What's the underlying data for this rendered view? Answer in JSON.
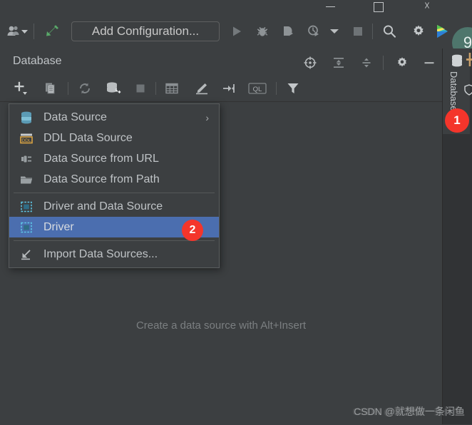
{
  "window": {
    "controls": {
      "minimize": "—",
      "maximize": "□",
      "close": "✕"
    }
  },
  "main_toolbar": {
    "profile_icon": "people-icon",
    "build_icon": "build-hammer-icon",
    "add_configuration_label": "Add Configuration...",
    "run_icon": "run-icon",
    "debug_icon": "debug-bug-icon",
    "coverage_icon": "run-with-coverage-icon",
    "profiler_icon": "profiler-icon",
    "profiler_dropdown_icon": "chevron-down-icon",
    "stop_icon": "stop-icon",
    "search_icon": "search-icon",
    "settings_icon": "gear-icon",
    "brand_icon": "ide-brand-icon",
    "avatar_label": "9"
  },
  "database_panel": {
    "title": "Database",
    "header_icons": {
      "locate": "locate-crosshair-icon",
      "expand_all": "expand-all-icon",
      "collapse_all": "collapse-all-icon",
      "settings": "gear-icon",
      "hide": "hide-minimize-icon"
    },
    "toolbar_icons": {
      "add": "plus-add-icon",
      "copy": "duplicate-icon",
      "refresh": "refresh-sync-icon",
      "db_tools": "database-tools-icon",
      "stop": "stop-icon",
      "table": "table-grid-icon",
      "edit": "edit-pencil-icon",
      "jump_to": "jump-to-icon",
      "ql": "QL",
      "filter": "filter-funnel-icon"
    },
    "empty_hint": "Create a data source with Alt+Insert"
  },
  "popup_menu": {
    "items": [
      {
        "label": "Data Source",
        "icon": "database-icon",
        "has_submenu": true,
        "submenu_arrow": "›",
        "selected": false,
        "separator_after": false
      },
      {
        "label": "DDL Data Source",
        "icon": "ddl-icon",
        "has_submenu": false,
        "selected": false,
        "separator_after": false
      },
      {
        "label": "Data Source from URL",
        "icon": "url-plug-icon",
        "has_submenu": false,
        "selected": false,
        "separator_after": false
      },
      {
        "label": "Data Source from Path",
        "icon": "folder-icon",
        "has_submenu": false,
        "selected": false,
        "separator_after": true
      },
      {
        "label": "Driver and Data Source",
        "icon": "driver-icon",
        "has_submenu": false,
        "selected": false,
        "separator_after": false
      },
      {
        "label": "Driver",
        "icon": "driver-icon",
        "has_submenu": false,
        "selected": true,
        "separator_after": true
      },
      {
        "label": "Import Data Sources...",
        "icon": "import-arrow-icon",
        "has_submenu": false,
        "selected": false,
        "separator_after": false
      }
    ]
  },
  "right_stripe": {
    "database_label": "Database",
    "database_icon": "database-icon",
    "hash_icon": "hash-icon",
    "shield_icon": "shield-icon"
  },
  "badges": {
    "step_one": "1",
    "step_two": "2"
  },
  "watermark": {
    "text": "CSDN @就想做一条闲鱼"
  },
  "colors": {
    "background": "#3c3f41",
    "panel_dark": "#313335",
    "selection_blue": "#4b6eaf",
    "badge_red": "#f4352b",
    "text": "#bfc3c6",
    "muted_text": "#7b7f81",
    "icon_grey": "#9aa0a3",
    "db_icon_blue": "#5b9bb5",
    "build_green": "#59a869",
    "ddl_orange": "#d9a343"
  }
}
